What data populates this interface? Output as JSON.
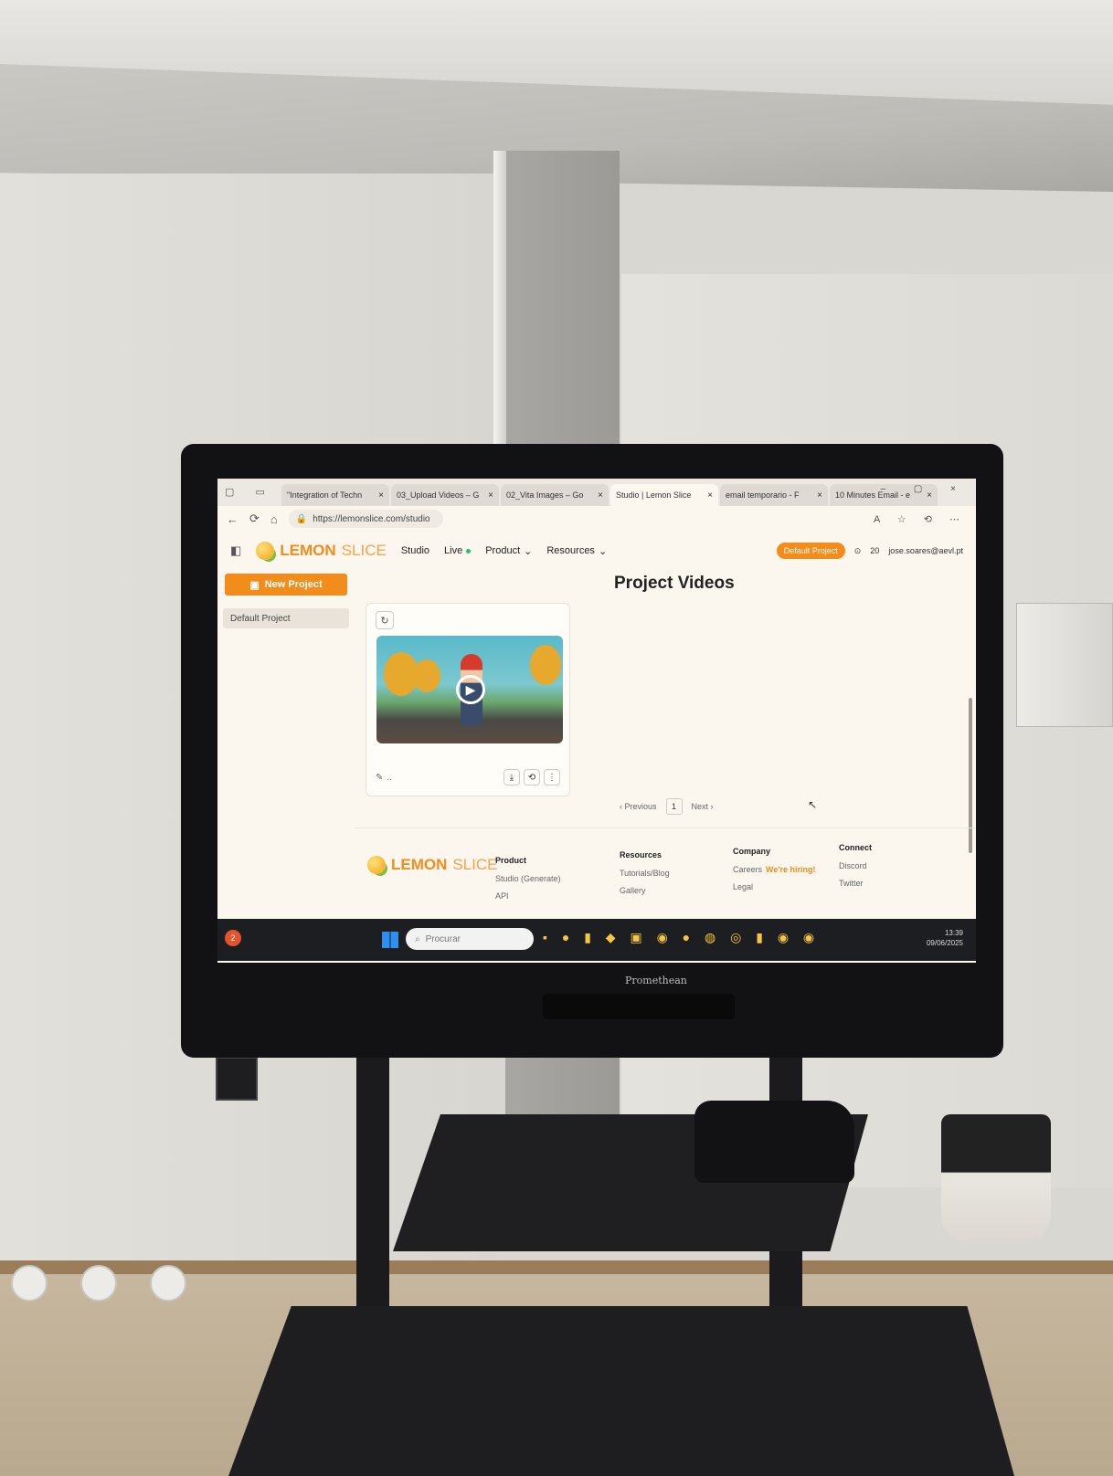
{
  "browser": {
    "tabs": [
      {
        "label": "\"Integration of Techn",
        "active": false
      },
      {
        "label": "03_Upload Videos – G",
        "active": false
      },
      {
        "label": "02_Vita Images – Go",
        "active": false
      },
      {
        "label": "Studio | Lemon Slice",
        "active": true
      },
      {
        "label": "email temporario - F",
        "active": false
      },
      {
        "label": "10 Minutes Email - e",
        "active": false
      }
    ],
    "url": "https://lemonslice.com/studio"
  },
  "nav": {
    "logo_bold": "LEMON",
    "logo_light": "SLICE",
    "studio": "Studio",
    "live": "Live",
    "product": "Product",
    "resources": "Resources",
    "project_pill": "Default Project",
    "credits": "20",
    "email": "jose.soares@aevl.pt"
  },
  "sidebar": {
    "new_project": "New Project",
    "items": [
      "Default Project"
    ]
  },
  "main": {
    "heading": "Project Videos",
    "card_caption": "..",
    "pager": {
      "previous": "‹ Previous",
      "page": "1",
      "next": "Next ›"
    }
  },
  "footer": {
    "logo_bold": "LEMON",
    "logo_light": "SLICE",
    "product": {
      "heading": "Product",
      "items": [
        "Studio (Generate)",
        "API"
      ]
    },
    "resources": {
      "heading": "Resources",
      "items": [
        "Tutorials/Blog",
        "Gallery"
      ]
    },
    "company": {
      "heading": "Company",
      "careers": "Careers",
      "hiring": "We're hiring!",
      "items": [
        "Legal"
      ]
    },
    "connect": {
      "heading": "Connect",
      "items": [
        "Discord",
        "Twitter"
      ]
    }
  },
  "taskbar": {
    "search_placeholder": "Procurar",
    "notif_count": "2",
    "time": "13:39",
    "date": "09/06/2025"
  },
  "monitor_brand": "Promethean",
  "colors": {
    "accent": "#f28c1b",
    "live": "#29c35b"
  }
}
